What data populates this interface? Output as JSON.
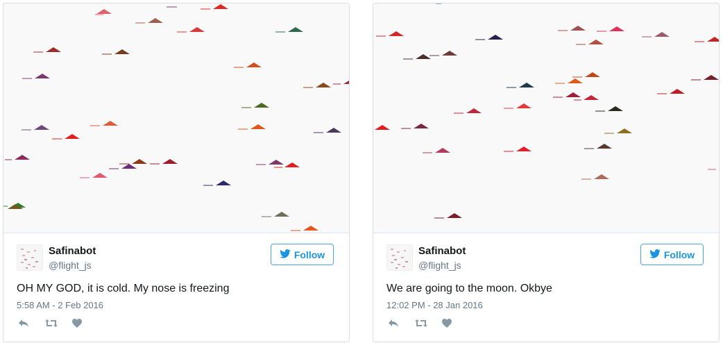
{
  "tweets": [
    {
      "name": "Safinabot",
      "handle": "@flight_js",
      "follow_label": "Follow",
      "text": "OH MY GOD, it is cold. My nose is freezing",
      "timestamp": "5:58 AM - 2 Feb 2016"
    },
    {
      "name": "Safinabot",
      "handle": "@flight_js",
      "follow_label": "Follow",
      "text": "We are going to the moon. Okbye",
      "timestamp": "12:02 PM - 28 Jan 2016"
    }
  ],
  "colors": {
    "follow_blue": "#1b95e0",
    "text_dark": "#14171a",
    "text_muted": "#657786",
    "media_bg": "#f9f9f9"
  },
  "icons": [
    "twitter-bird-icon",
    "reply-icon",
    "retweet-icon",
    "heart-icon"
  ]
}
